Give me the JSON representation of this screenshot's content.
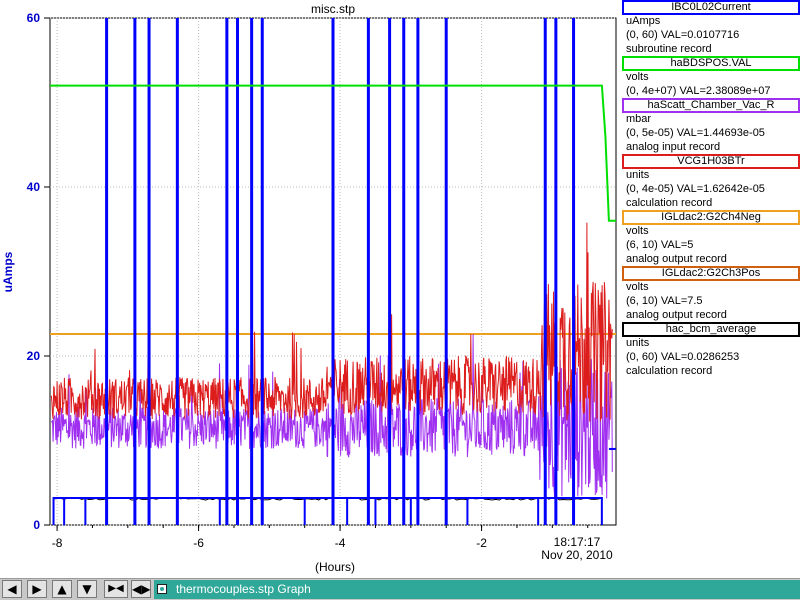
{
  "chart_data": {
    "type": "line",
    "title": "misc.stp",
    "ylabel": "uAmps",
    "xlabel": "(Hours)",
    "xlim": [
      -8.1,
      -0.1
    ],
    "ylim": [
      0,
      60
    ],
    "x_ticks": [
      -8,
      -6,
      -4,
      -2
    ],
    "y_ticks": [
      0,
      20,
      40,
      60
    ],
    "grid": true,
    "time_marker": {
      "label_time": "18:17:17",
      "label_date": "Nov 20, 2010"
    },
    "series": [
      {
        "name": "IBC0L02Current",
        "color": "#0000ff",
        "baseline": 3.2,
        "spikes_x": [
          -7.3,
          -6.9,
          -6.7,
          -6.3,
          -5.6,
          -5.45,
          -5.25,
          -5.1,
          -4.1,
          -3.6,
          -3.3,
          -3.1,
          -2.9,
          -2.5,
          -1.1,
          -0.95,
          -0.7
        ],
        "dips_x": [
          -7.9,
          -7.6,
          -5.7,
          -4.5,
          -4.1,
          -3.9,
          -3.5,
          -3.0,
          -2.2,
          -1.2
        ]
      },
      {
        "name": "haBDSPOS.VAL",
        "color": "#00e000",
        "points": [
          [
            -8.1,
            52
          ],
          [
            -0.3,
            52
          ],
          [
            -0.25,
            46
          ],
          [
            -0.22,
            40
          ],
          [
            -0.2,
            36
          ],
          [
            -0.1,
            36
          ]
        ]
      },
      {
        "name": "haScatt_Chamber_Vac_R",
        "color": "#a030f0",
        "level": 11.5,
        "noise": 2.5
      },
      {
        "name": "VCG1H03BTr",
        "color": "#dd1c1c",
        "level": 15,
        "noise": 2.5
      },
      {
        "name": "IGLdac2:G2Ch4Neg",
        "color": "#f0a020",
        "value": 22.6
      },
      {
        "name": "IGLdac2:G2Ch3Pos",
        "color": "#d06010",
        "value": 22.6
      },
      {
        "name": "hac_bcm_average",
        "color": "#000000",
        "level": 3.1
      }
    ]
  },
  "legend": [
    {
      "name": "IBC0L02Current",
      "border": "#0000ff",
      "unit": "uAmps",
      "range": "(0, 60) VAL=0.0107716",
      "rtype": "subroutine record"
    },
    {
      "name": "haBDSPOS.VAL",
      "border": "#00e000",
      "unit": "volts",
      "range": "(0, 4e+07) VAL=2.38089e+07",
      "rtype": ""
    },
    {
      "name": "haScatt_Chamber_Vac_R",
      "border": "#a030f0",
      "unit": "mbar",
      "range": "(0, 5e-05) VAL=1.44693e-05",
      "rtype": "analog input record"
    },
    {
      "name": "VCG1H03BTr",
      "border": "#dd1c1c",
      "unit": "units",
      "range": "(0, 4e-05) VAL=1.62642e-05",
      "rtype": "calculation record"
    },
    {
      "name": "IGLdac2:G2Ch4Neg",
      "border": "#f0a020",
      "unit": "volts",
      "range": "(6, 10) VAL=5",
      "rtype": "analog output record"
    },
    {
      "name": "IGLdac2:G2Ch3Pos",
      "border": "#d06010",
      "unit": "volts",
      "range": "(6, 10) VAL=7.5",
      "rtype": "analog output record"
    },
    {
      "name": "hac_bcm_average",
      "border": "#000000",
      "unit": "units",
      "range": "(0, 60) VAL=0.0286253",
      "rtype": "calculation record"
    }
  ],
  "bottom": {
    "nav": [
      "◀",
      "▶",
      "▲",
      "▼",
      "▶◀"
    ],
    "nav_icons": [
      "arrow-left-icon",
      "arrow-right-icon",
      "arrow-up-icon",
      "arrow-down-icon",
      "shrink-icon"
    ],
    "tab_label": "thermocouples.stp Graph"
  }
}
